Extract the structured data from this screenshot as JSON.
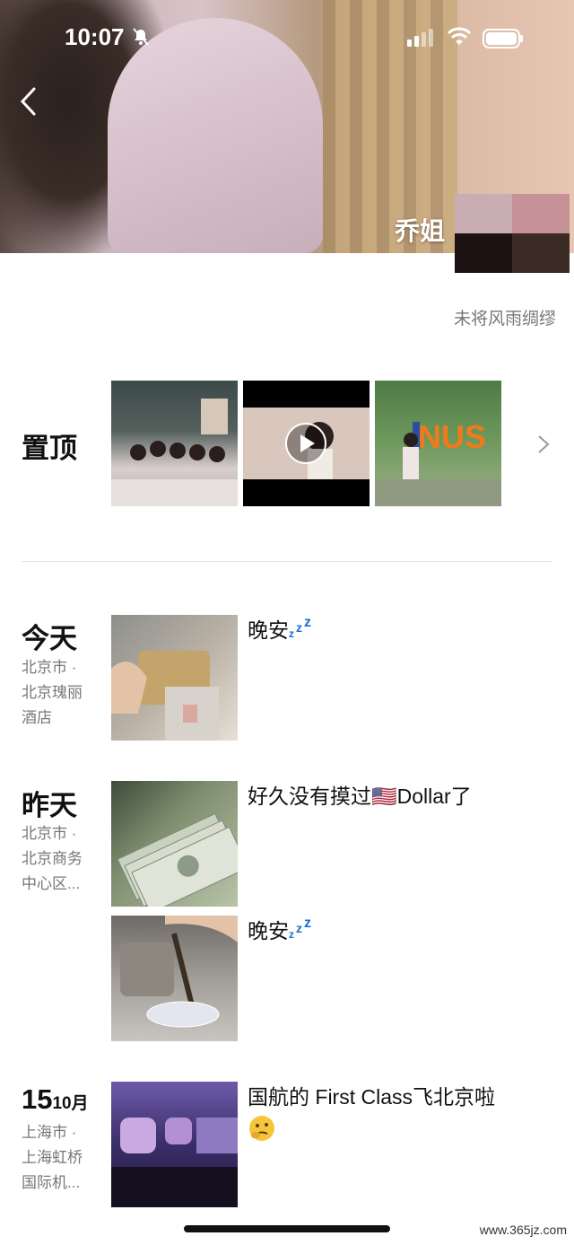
{
  "status_bar": {
    "time": "10:07"
  },
  "profile": {
    "name": "乔姐",
    "signature": "未将风雨绸缪"
  },
  "pinned": {
    "label": "置顶",
    "thumb_count": 3
  },
  "posts": [
    {
      "day": "今天",
      "location_lines": [
        "北京市 ·",
        "北京瑰丽",
        "酒店"
      ],
      "text": "晚安",
      "emoji": "zzz-icon"
    },
    {
      "day": "昨天",
      "location_lines": [
        "北京市 ·",
        "北京商务",
        "中心区..."
      ],
      "text": "好久没有摸过🇺🇸Dollar了"
    },
    {
      "day": "",
      "location_lines": [],
      "text": "晚安",
      "emoji": "zzz-icon"
    },
    {
      "day_num": "15",
      "day_month": "10月",
      "location_lines": [
        "上海市 ·",
        "上海虹桥",
        "国际机..."
      ],
      "text": "国航的 First Class飞北京啦"
    }
  ],
  "watermark": "www.365jz.com",
  "colors": {
    "zzz": "#1a6fd0",
    "secondary_text": "#777777"
  }
}
